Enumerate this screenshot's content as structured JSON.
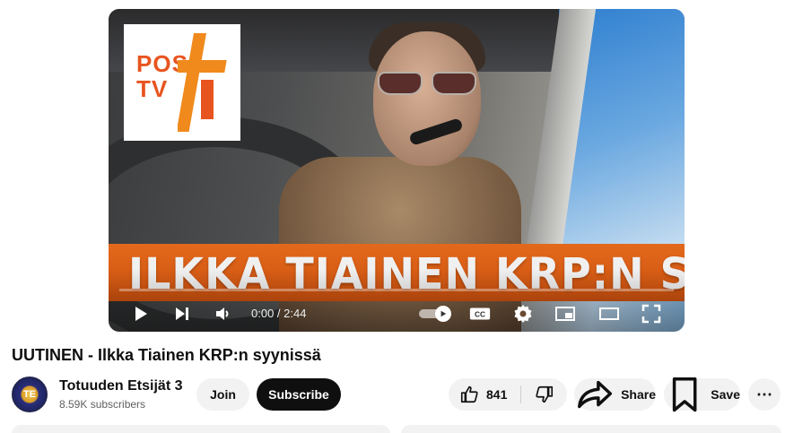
{
  "video": {
    "logo_lines": [
      "POSI",
      "TV"
    ],
    "banner_text": "ILKKA TIAINEN KRP:N SYYNISSÄ",
    "progress_fraction": 0.0,
    "time": "0:00 / 2:44",
    "autoplay_on": true,
    "accent": "#ff0000",
    "banner_color": "#e2691c",
    "controls": {
      "play": "play-icon",
      "next": "next-icon",
      "volume": "volume-icon",
      "autoplay": "autoplay-toggle-icon",
      "captions": "cc-icon",
      "settings": "gear-icon",
      "miniplayer": "miniplayer-icon",
      "theater": "theater-icon",
      "fullscreen": "fullscreen-icon"
    },
    "captions_label": "CC"
  },
  "title": "UUTINEN - Ilkka Tiainen KRP:n syynissä",
  "channel": {
    "name": "Totuuden Etsijät 3",
    "subscribers": "8.59K subscribers",
    "avatar_text": "TE"
  },
  "actions": {
    "join": "Join",
    "subscribe": "Subscribe",
    "like_count": "841",
    "share": "Share",
    "save": "Save",
    "more": "⋯"
  }
}
